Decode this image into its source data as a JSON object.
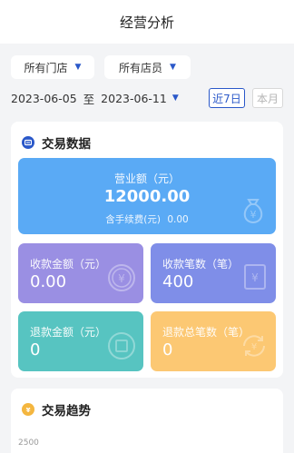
{
  "header": {
    "title": "经营分析"
  },
  "filters": {
    "store_select": "所有门店",
    "staff_select": "所有店员",
    "date_start": "2023-06-05",
    "date_sep": "至",
    "date_end": "2023-06-11",
    "quick_7d": "近7日",
    "quick_month": "本月"
  },
  "transaction_data": {
    "title": "交易数据",
    "revenue": {
      "label": "营业额（元）",
      "value": "12000.00",
      "fee_label": "含手续费(元)",
      "fee_value": "0.00"
    },
    "received_amount": {
      "label": "收款金额（元）",
      "value": "0.00"
    },
    "received_count": {
      "label": "收款笔数（笔）",
      "value": "400"
    },
    "refund_amount": {
      "label": "退款金额（元）",
      "value": "0"
    },
    "refund_count": {
      "label": "退款总笔数（笔）",
      "value": "0"
    }
  },
  "trend": {
    "title": "交易趋势",
    "y_tick_top": "2500"
  },
  "colors": {
    "accent": "#2a58c9",
    "revenue_card": "#5aaaf5",
    "received_amount_card": "#9a8fe3",
    "received_count_card": "#7f8ee8",
    "refund_amount_card": "#57c4c1",
    "refund_count_card": "#fcc873"
  },
  "icons": {
    "transaction_title_icon": "wallet-icon",
    "trend_title_icon": "coin-icon",
    "revenue_watermark": "money-bag-icon",
    "received_amount_watermark": "yuan-coin-icon",
    "received_count_watermark": "receipt-icon",
    "refund_amount_watermark": "refund-coin-icon",
    "refund_count_watermark": "refund-cycle-icon"
  }
}
